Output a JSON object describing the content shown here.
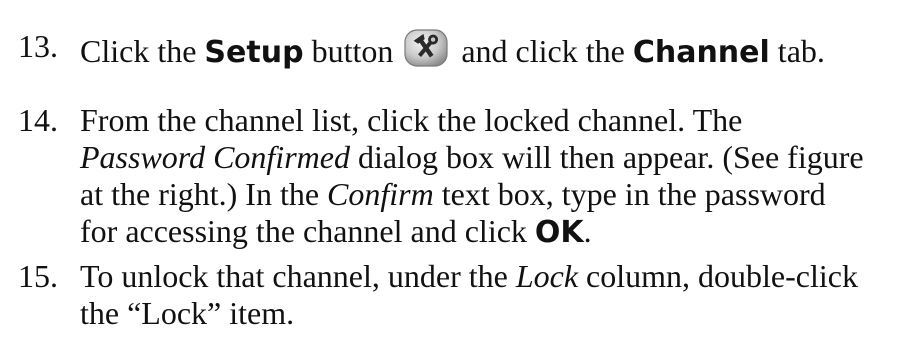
{
  "steps": [
    {
      "number": "13.",
      "parts": {
        "p1": "Click the ",
        "b1": "Setup",
        "p2": " button ",
        "p3": " and click the ",
        "b2": "Channel",
        "p4": " tab."
      },
      "icon": "setup-tools-icon"
    },
    {
      "number": "14.",
      "lines": {
        "l1": "From the channel list, click the locked channel. The",
        "l2_i1": "Password Confirmed",
        "l2_p1": " dialog box will then appear. (See figure",
        "l3_p1": "at the right.)  In the ",
        "l3_i1": "Confirm",
        "l3_p2": " text box, type in the password",
        "l4_p1": "for accessing the channel and click ",
        "l4_b1": "OK",
        "l4_p2": "."
      }
    },
    {
      "number": "15.",
      "lines": {
        "l1_p1": "To unlock that channel, under the ",
        "l1_i1": "Lock",
        "l1_p2": " column, double-click",
        "l2": "the “Lock” item."
      }
    }
  ],
  "colors": {
    "text": "#111111",
    "icon_bg": "#c8c8c8",
    "icon_tool": "#2a2a2a"
  }
}
